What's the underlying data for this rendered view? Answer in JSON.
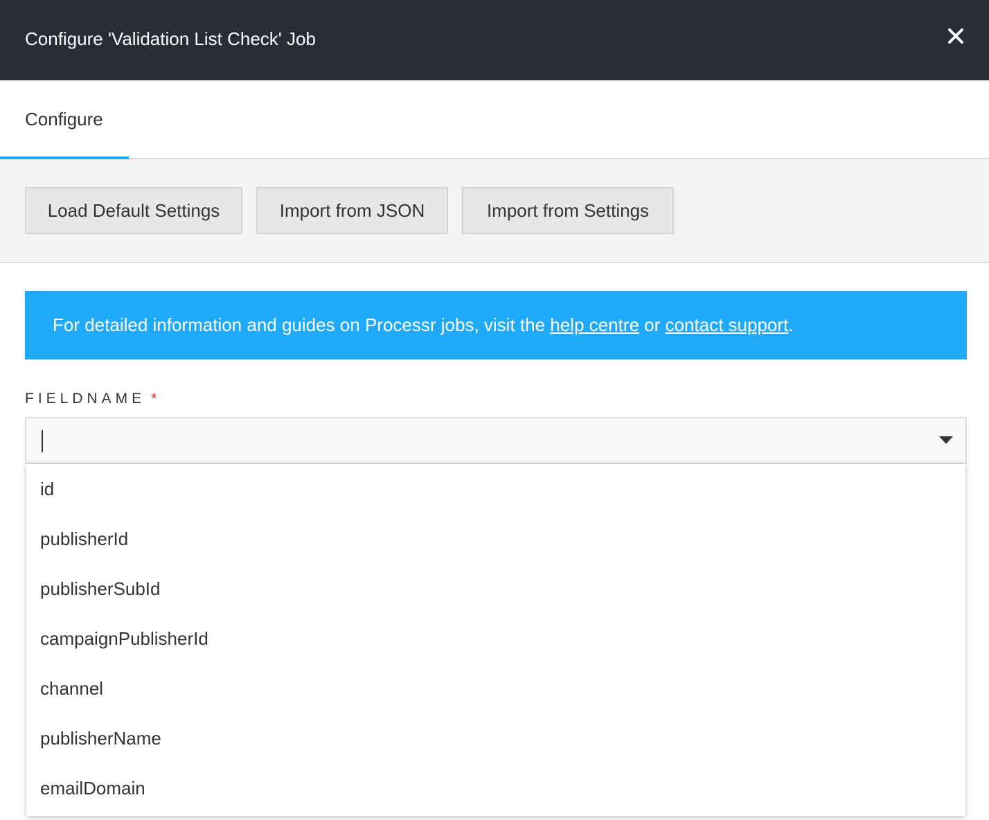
{
  "modal": {
    "title": "Configure 'Validation List Check' Job",
    "close_icon": "close-icon"
  },
  "tabs": [
    {
      "label": "Configure",
      "active": true
    }
  ],
  "toolbar": {
    "load_default": "Load Default Settings",
    "import_json": "Import from JSON",
    "import_settings": "Import from Settings"
  },
  "info": {
    "prefix": "For detailed information and guides on Processr jobs, visit the ",
    "help_link": "help centre",
    "middle": " or ",
    "support_link": "contact support",
    "suffix": "."
  },
  "field": {
    "label": "FIELDNAME",
    "required_mark": "*",
    "value": "",
    "arrow_icon": "dropdown-arrow-icon",
    "options": [
      "id",
      "publisherId",
      "publisherSubId",
      "campaignPublisherId",
      "channel",
      "publisherName",
      "emailDomain"
    ]
  },
  "colors": {
    "header_bg": "#282d38",
    "accent": "#1eaaf1",
    "banner_bg": "#1eaaf8",
    "required": "#e02020"
  }
}
